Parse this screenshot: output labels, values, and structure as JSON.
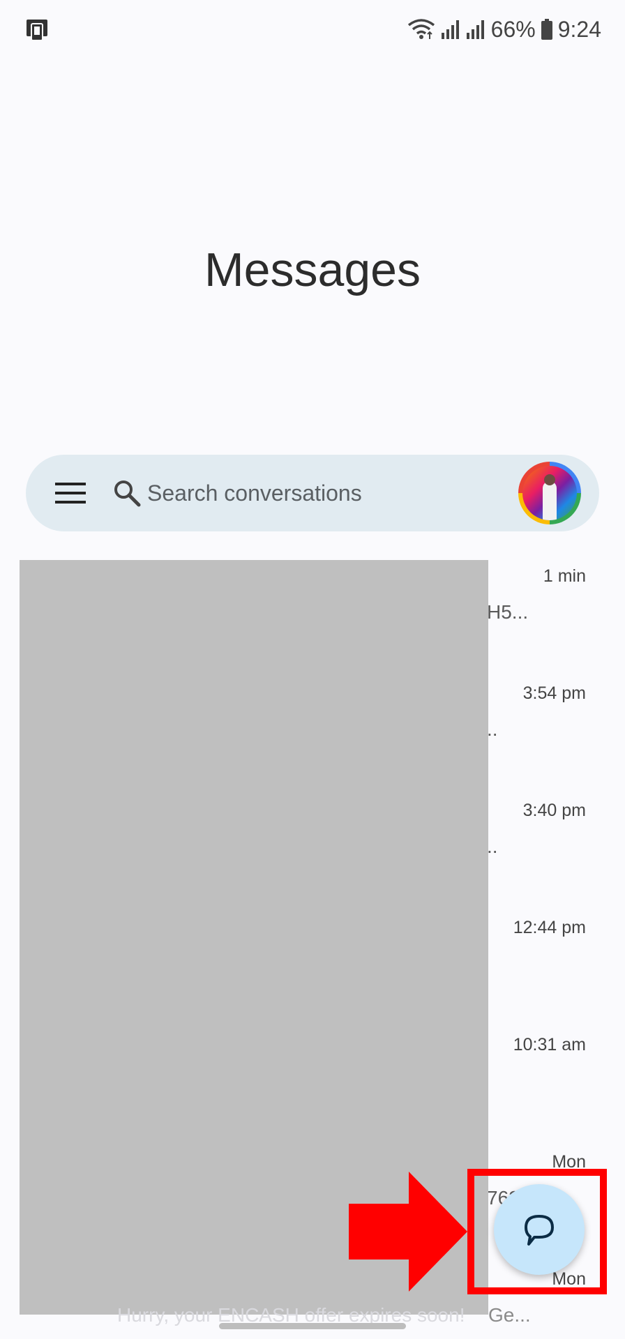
{
  "status_bar": {
    "battery": "66%",
    "time": "9:24"
  },
  "header": {
    "title": "Messages"
  },
  "search": {
    "placeholder": "Search conversations"
  },
  "conversations": [
    {
      "time": "1 min",
      "snippet": "H5..."
    },
    {
      "time": "3:54 pm",
      "snippet": ".."
    },
    {
      "time": "3:40 pm",
      "snippet": ".."
    },
    {
      "time": "12:44 pm",
      "snippet": ""
    },
    {
      "time": "10:31 am",
      "snippet": ""
    },
    {
      "time": "Mon",
      "snippet": "762"
    },
    {
      "time": "Mon",
      "snippet": ""
    }
  ],
  "bottom_partial": {
    "text": "Hurry, your ENCASH offer expires soon!",
    "text_end": "Ge..."
  },
  "colors": {
    "background": "#fafafd",
    "search_bar": "#e1ebf1",
    "fab": "#c6e6fb",
    "annotation": "#ff0000",
    "redaction": "#bfbfbf"
  },
  "icons": {
    "status_left": "phone-sync-icon",
    "wifi": "wifi-icon",
    "signal": "signal-icon",
    "battery": "battery-icon",
    "menu": "hamburger-menu-icon",
    "search": "search-icon",
    "fab": "start-chat-icon"
  }
}
